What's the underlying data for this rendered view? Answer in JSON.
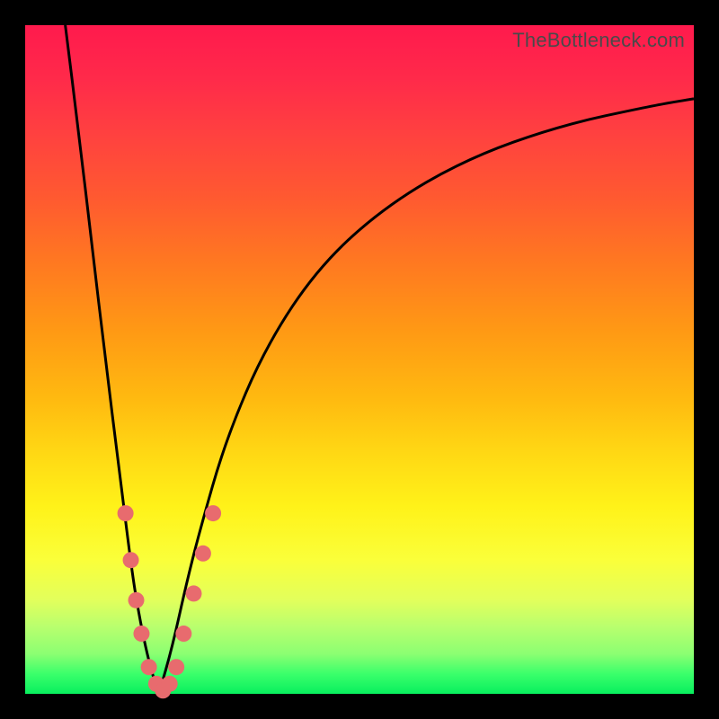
{
  "attribution": "TheBottleneck.com",
  "colors": {
    "frame": "#000000",
    "marker": "#e86b6e",
    "curve": "#000000",
    "gradient_top": "#ff1a4d",
    "gradient_bottom": "#08ef5e"
  },
  "chart_data": {
    "type": "line",
    "title": "",
    "xlabel": "",
    "ylabel": "",
    "xlim": [
      0,
      100
    ],
    "ylim": [
      0,
      100
    ],
    "note": "Axes have no tick labels; values are read as percentage of plot width/height. y=0 is the bottom (green), y=100 is the top (red). The two black curves form a V meeting near x≈20, y≈0.",
    "series": [
      {
        "name": "left-curve",
        "x": [
          6,
          8,
          10,
          12,
          14,
          16,
          17,
          18,
          19,
          20
        ],
        "y": [
          100,
          84,
          67,
          50,
          34,
          18,
          12,
          7,
          3,
          0
        ]
      },
      {
        "name": "right-curve",
        "x": [
          20,
          22,
          24,
          26,
          30,
          36,
          44,
          54,
          66,
          80,
          94,
          100
        ],
        "y": [
          0,
          7,
          16,
          24,
          38,
          52,
          64,
          73,
          80,
          85,
          88,
          89
        ]
      }
    ],
    "markers": {
      "name": "highlighted-points",
      "color": "#e86b6e",
      "points": [
        {
          "x": 15.0,
          "y": 27
        },
        {
          "x": 15.8,
          "y": 20
        },
        {
          "x": 16.6,
          "y": 14
        },
        {
          "x": 17.4,
          "y": 9
        },
        {
          "x": 18.5,
          "y": 4
        },
        {
          "x": 19.6,
          "y": 1.5
        },
        {
          "x": 20.6,
          "y": 0.5
        },
        {
          "x": 21.6,
          "y": 1.5
        },
        {
          "x": 22.6,
          "y": 4
        },
        {
          "x": 23.7,
          "y": 9
        },
        {
          "x": 25.2,
          "y": 15
        },
        {
          "x": 26.6,
          "y": 21
        },
        {
          "x": 28.1,
          "y": 27
        }
      ]
    }
  }
}
